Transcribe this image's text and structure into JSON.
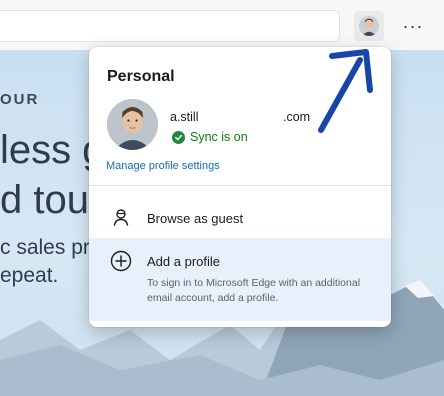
{
  "toolbar": {
    "more_label": "···"
  },
  "web_page": {
    "eyebrow": "OUR",
    "headline_line1": "less g",
    "headline_line2": "d tour",
    "sub_line1": "c sales pro",
    "sub_line2": "epeat."
  },
  "flyout": {
    "title": "Personal",
    "email_left": "a.still",
    "email_right": ".com",
    "sync_status": "Sync is on",
    "manage_link": "Manage profile settings",
    "guest_label": "Browse as guest",
    "add_profile_label": "Add a profile",
    "add_profile_desc": "To sign in to Microsoft Edge with an additional email account, add a profile."
  },
  "icons": {
    "sync": "check-circle-icon",
    "guest": "guest-person-icon",
    "add": "plus-circle-icon",
    "more": "ellipsis-icon"
  },
  "colors": {
    "accent_link": "#0f6cbd",
    "sync_green": "#107c10",
    "hover_bg": "#e8f1fb",
    "annotation_arrow": "#1745a8"
  }
}
